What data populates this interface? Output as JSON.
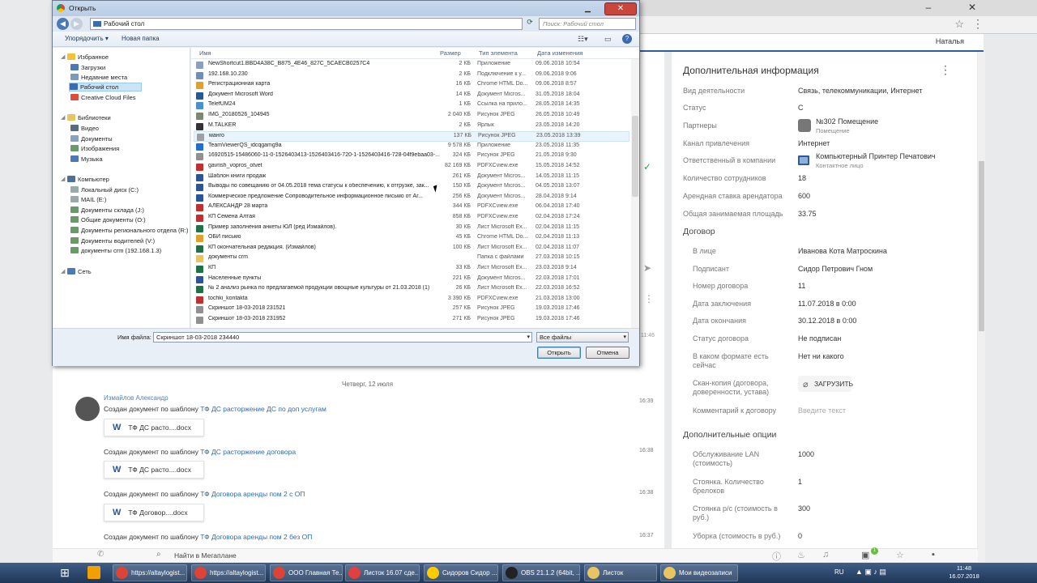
{
  "browser": {
    "user_name": "Наталья",
    "minimize_glyph": "–",
    "close_glyph": "✕",
    "star_glyph": "☆",
    "menu_glyph": "⋮"
  },
  "right_panel": {
    "title": "Дополнительная информация",
    "fields": [
      {
        "label": "Вид деятельности",
        "value": "Связь, телекоммуникации, Интернет"
      },
      {
        "label": "Статус",
        "value": "С"
      },
      {
        "label": "Партнеры",
        "value": "№302 Помещение",
        "sub": "Помещение"
      },
      {
        "label": "Канал привлечения",
        "value": "Интернет"
      },
      {
        "label": "Ответственный в компании",
        "value": "Компьютерный Принтер Печатович",
        "sub": "Контактное лицо"
      },
      {
        "label": "Количество сотрудников",
        "value": "18"
      },
      {
        "label": "Арендная ставка арендатора",
        "value": "600"
      },
      {
        "label": "Общая занимаемая площадь",
        "value": "33.75"
      }
    ],
    "contract_title": "Договор",
    "contract_fields": [
      {
        "label": "В лице",
        "value": "Иванова Кота Матроскина"
      },
      {
        "label": "Подписант",
        "value": "Сидор Петрович Гном"
      },
      {
        "label": "Номер договора",
        "value": "11"
      },
      {
        "label": "Дата заключения",
        "value": "11.07.2018 в 0:00"
      },
      {
        "label": "Дата окончания",
        "value": "30.12.2018 в 0:00"
      },
      {
        "label": "Статус договора",
        "value": "Не подписан"
      },
      {
        "label": "В каком формате есть сейчас",
        "value": "Нет ни какого"
      },
      {
        "label": "Скан-копия (договора, доверенности, устава)",
        "value": "ЗАГРУЗИТЬ"
      },
      {
        "label": "Комментарий к договору",
        "value": "Введите текст"
      }
    ],
    "options_title": "Дополнительные опции",
    "options_fields": [
      {
        "label": "Обслуживание LAN (стоимость)",
        "value": "1000"
      },
      {
        "label": "Стоянка. Количество брелоков",
        "value": "1"
      },
      {
        "label": "Стоянка р/с (стоимость в руб.)",
        "value": "300"
      },
      {
        "label": "Уборка (стоимость в руб.)",
        "value": "0"
      }
    ]
  },
  "timeline": {
    "date": "Четверг, 12 июля",
    "author": "Измайлов Александр",
    "entries": [
      {
        "prefix": "Создан документ по шаблону",
        "link": "ТФ ДС расторжение ДС по доп услугам",
        "time": "16:39",
        "doc": "ТФ ДС расто....docx"
      },
      {
        "prefix": "Создан документ по шаблону",
        "link": "ТФ ДС расторжение договора",
        "time": "16:38",
        "doc": "ТФ ДС расто....docx"
      },
      {
        "prefix": "Создан документ по шаблону",
        "link": "ТФ Договора аренды пом 2 с ОП",
        "time": "16:38",
        "doc": "ТФ Договор....docx"
      },
      {
        "prefix": "Создан документ по шаблону",
        "link": "ТФ Договора аренды пом 2 без ОП",
        "time": "16:37"
      }
    ],
    "side_time": "11:46",
    "word_letter": "W"
  },
  "bottombar": {
    "search_placeholder": "Найти в Мегаплане",
    "badge": "1"
  },
  "dialog": {
    "title": "Открыть",
    "address": "Рабочий стол",
    "search_placeholder": "Поиск: Рабочий стол",
    "organize": "Упорядочить ▾",
    "new_folder": "Новая папка",
    "help": "?",
    "nav": {
      "favorites": "Избранное",
      "favorites_items": [
        "Загрузки",
        "Недавние места",
        "Рабочий стол",
        "Creative Cloud Files"
      ],
      "libraries": "Библиотеки",
      "libraries_items": [
        "Видео",
        "Документы",
        "Изображения",
        "Музыка"
      ],
      "computer": "Компьютер",
      "computer_items": [
        "Локальный диск (C:)",
        "MAIL (E:)",
        "Документы склада (J:)",
        "Общие документы (O:)",
        "Документы регионального отдела (R:)",
        "Документы водителей (V:)",
        "документы crm (192.168.1.3)"
      ],
      "network": "Сеть"
    },
    "columns": {
      "name": "Имя",
      "size": "Размер",
      "type": "Тип элемента",
      "date": "Дата изменения"
    },
    "files": [
      {
        "name": "NewShortcut1.BBD4A38C_B875_4E46_827C_5CAECB0257C4",
        "size": "2 КБ",
        "type": "Приложение",
        "date": "09.06.2018 10:54",
        "icon": "#8aa0c0"
      },
      {
        "name": "192.168.10.230",
        "size": "2 КБ",
        "type": "Подключение к у...",
        "date": "09.06.2018 9:06",
        "icon": "#6f8fb8"
      },
      {
        "name": "Регистрационная карта",
        "size": "16 КБ",
        "type": "Chrome HTML Do...",
        "date": "09.06.2018 8:57",
        "icon": "#e0a030"
      },
      {
        "name": "Документ Microsoft Word",
        "size": "14 КБ",
        "type": "Документ Micros...",
        "date": "31.05.2018 18:04",
        "icon": "#2a5699"
      },
      {
        "name": "TelefUM24",
        "size": "1 КБ",
        "type": "Ссылка на прило...",
        "date": "28.05.2018 14:35",
        "icon": "#4a90d0"
      },
      {
        "name": "IMG_20180526_104945",
        "size": "2 040 КБ",
        "type": "Рисунок JPEG",
        "date": "26.05.2018 10:49",
        "icon": "#7a8a70"
      },
      {
        "name": "M.TALKER",
        "size": "2 КБ",
        "type": "Ярлык",
        "date": "23.05.2018 14:20",
        "icon": "#333333"
      },
      {
        "name": "манго",
        "size": "137 КБ",
        "type": "Рисунок JPEG",
        "date": "23.05.2018 13:39",
        "icon": "#a0a0a0"
      },
      {
        "name": "TeamViewerQS_idcqgamg9a",
        "size": "9 578 КБ",
        "type": "Приложение",
        "date": "23.05.2018 11:35",
        "icon": "#1e6fd0"
      },
      {
        "name": "16920515-15486060-11-0-1526403413-1526403416-720-1-1526403416-728-04f9ebaa03-...",
        "size": "324 КБ",
        "type": "Рисунок JPEG",
        "date": "21.05.2018 9:30",
        "icon": "#909090"
      },
      {
        "name": "gavrish_vopros_otvet",
        "size": "82 169 КБ",
        "type": "PDFXCview.exe",
        "date": "15.05.2018 14:52",
        "icon": "#c03030"
      },
      {
        "name": "Шаблон книги продаж",
        "size": "261 КБ",
        "type": "Документ Micros...",
        "date": "14.05.2018 11:15",
        "icon": "#2a5699"
      },
      {
        "name": "Выводы по совещанию от 04.05.2018 тема статусы к обеспечению, к отгрузке, зак...",
        "size": "150 КБ",
        "type": "Документ Micros...",
        "date": "04.05.2018 13:07",
        "icon": "#2a5699"
      },
      {
        "name": "Коммерческое предложение Сопроводительное информационное письмо от Ar...",
        "size": "256 КБ",
        "type": "Документ Micros...",
        "date": "28.04.2018 9:14",
        "icon": "#2a5699"
      },
      {
        "name": "АЛЕКСАНДР 28 марта",
        "size": "344 КБ",
        "type": "PDFXCview.exe",
        "date": "06.04.2018 17:40",
        "icon": "#c03030"
      },
      {
        "name": "КП Семена Алтая",
        "size": "858 КБ",
        "type": "PDFXCview.exe",
        "date": "02.04.2018 17:24",
        "icon": "#c03030"
      },
      {
        "name": "Пример заполнения анкеты ЮЛ (ред Измайлов).",
        "size": "30 КБ",
        "type": "Лист Microsoft Ex...",
        "date": "02.04.2018 11:15",
        "icon": "#207245"
      },
      {
        "name": "ОБИ письмо",
        "size": "45 КБ",
        "type": "Chrome HTML Do...",
        "date": "02.04.2018 11:13",
        "icon": "#e0a030"
      },
      {
        "name": "КП окончательная редакция. (Измайлов)",
        "size": "100 КБ",
        "type": "Лист Microsoft Ex...",
        "date": "02.04.2018 11:07",
        "icon": "#207245"
      },
      {
        "name": "документы crm",
        "size": "",
        "type": "Папка с файлами",
        "date": "27.03.2018 10:15",
        "icon": "#e8c560"
      },
      {
        "name": "КП",
        "size": "33 КБ",
        "type": "Лист Microsoft Ex...",
        "date": "23.03.2018 9:14",
        "icon": "#207245"
      },
      {
        "name": "Населенные пункты",
        "size": "221 КБ",
        "type": "Документ Micros...",
        "date": "22.03.2018 17:01",
        "icon": "#2a5699"
      },
      {
        "name": "№ 2 анализ рынка по предлагаемой продукции овощные культуры от 21.03.2018 (1)",
        "size": "26 КБ",
        "type": "Лист Microsoft Ex...",
        "date": "22.03.2018 16:52",
        "icon": "#207245"
      },
      {
        "name": "tochki_kontakta",
        "size": "3 390 КБ",
        "type": "PDFXCview.exe",
        "date": "21.03.2018 13:00",
        "icon": "#c03030"
      },
      {
        "name": "Скриншот 18-03-2018 231521",
        "size": "257 КБ",
        "type": "Рисунок JPEG",
        "date": "19.03.2018 17:46",
        "icon": "#909090"
      },
      {
        "name": "Скриншот 18-03-2018 231952",
        "size": "271 КБ",
        "type": "Рисунок JPEG",
        "date": "19.03.2018 17:46",
        "icon": "#909090"
      }
    ],
    "filename_label": "Имя файла:",
    "filename_value": "Скриншот 18-03-2018 234440",
    "filetype_value": "Все файлы",
    "open_button": "Открыть",
    "cancel_button": "Отмена"
  },
  "taskbar": {
    "items": [
      {
        "label": "https://altaylogist...",
        "color": "#db4437"
      },
      {
        "label": "https://altaylogist...",
        "color": "#db4437"
      },
      {
        "label": "ООО Главная Те...",
        "color": "#db4437"
      },
      {
        "label": "Листок 16.07 сде...",
        "color": "#e04040"
      },
      {
        "label": "Сидоров Сидор ...",
        "color": "#ffcc00"
      },
      {
        "label": "OBS 21.1.2 (64bit, ...",
        "color": "#222222"
      },
      {
        "label": "Листок",
        "color": "#e8c560"
      },
      {
        "label": "Мои видеозаписи",
        "color": "#e8c560"
      }
    ],
    "lang": "RU",
    "time": "11:48",
    "date": "16.07.2018"
  }
}
